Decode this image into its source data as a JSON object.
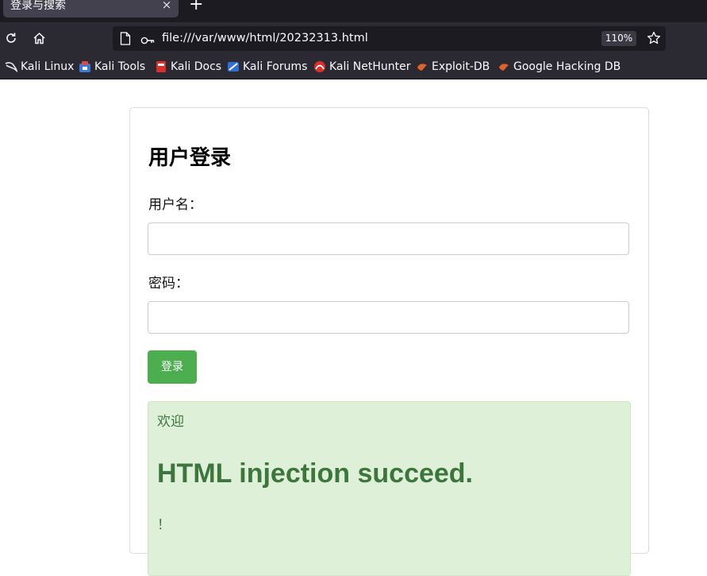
{
  "browser": {
    "tab": {
      "title": "登录与搜索",
      "close_glyph": "×"
    },
    "new_tab_glyph": "+",
    "url": "file:///var/www/html/20232313.html",
    "zoom": "110%",
    "bookmarks": [
      {
        "label": "Kali Linux",
        "icon": "kali-dragon-icon"
      },
      {
        "label": "Kali Tools",
        "icon": "kali-tools-icon"
      },
      {
        "label": "Kali Docs",
        "icon": "kali-docs-icon"
      },
      {
        "label": "Kali Forums",
        "icon": "kali-forums-icon"
      },
      {
        "label": "Kali NetHunter",
        "icon": "kali-nethunter-icon"
      },
      {
        "label": "Exploit-DB",
        "icon": "exploit-db-icon"
      },
      {
        "label": "Google Hacking DB",
        "icon": "ghdb-icon"
      }
    ]
  },
  "page": {
    "title": "用户登录",
    "username_label": "用户名：",
    "username_value": "",
    "password_label": "密码：",
    "password_value": "",
    "login_button": "登录",
    "result": {
      "welcome": "欢迎",
      "injected_heading": "HTML injection succeed.",
      "trailing": "！"
    }
  },
  "colors": {
    "accent_green": "#4cae4f",
    "success_bg": "#dff0d8",
    "success_text": "#3c763d"
  }
}
